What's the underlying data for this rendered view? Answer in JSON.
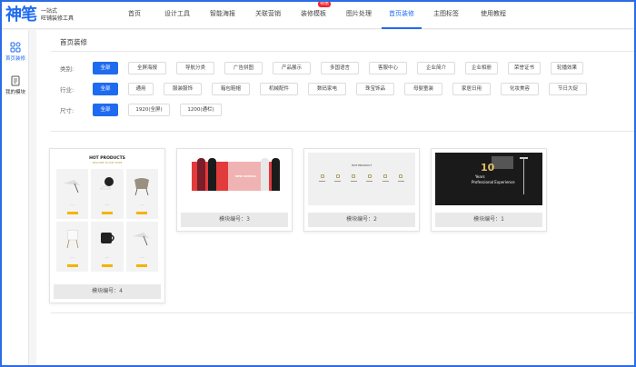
{
  "app": {
    "logo_mark": "神笔",
    "logo_line1": "一站式",
    "logo_line2": "旺铺装修工具"
  },
  "nav": {
    "items": [
      {
        "label": "首页"
      },
      {
        "label": "设计工具"
      },
      {
        "label": "智能海报"
      },
      {
        "label": "关联营销"
      },
      {
        "label": "装修模板",
        "badge": "特惠"
      },
      {
        "label": "图片处理"
      },
      {
        "label": "首页装修",
        "active": true
      },
      {
        "label": "主图标签"
      },
      {
        "label": "使用教程"
      }
    ]
  },
  "sidebar": {
    "items": [
      {
        "label": "首页装修",
        "icon": "grid-icon",
        "active": true
      },
      {
        "label": "我的模块",
        "icon": "document-icon"
      }
    ]
  },
  "page_title": "首页装修",
  "filters": {
    "category": {
      "label": "类别:",
      "options": [
        "全部",
        "全屏海报",
        "导航分类",
        "广告拼图",
        "产品展示",
        "多国语言",
        "客服中心",
        "企业简介",
        "企业相册",
        "荣誉证书",
        "轮播效果"
      ],
      "selected": "全部"
    },
    "industry": {
      "label": "行业:",
      "options": [
        "全部",
        "通用",
        "服装服饰",
        "箱包鞋帽",
        "机械配件",
        "数码家电",
        "珠宝饰品",
        "母婴童装",
        "家居日用",
        "化妆美容",
        "节日大促"
      ],
      "selected": "全部"
    },
    "size": {
      "label": "尺寸:",
      "options": [
        "全部",
        "1920(全屏)",
        "1200(通栏)"
      ],
      "selected": "全部"
    }
  },
  "templates": [
    {
      "label": "模块编号：4",
      "title": "HOT PRODUCTS",
      "subtitle": "WELCOME TO OUR STORE"
    },
    {
      "label": "模块编号：3",
      "thumb_text": "NEW ARRIVAL"
    },
    {
      "label": "模块编号：2",
      "thumb_text": "HOT PRODUCT"
    },
    {
      "label": "模块编号：1",
      "thumb_number": "10",
      "thumb_line1": "Years",
      "thumb_line2": "Professional Experience"
    }
  ],
  "colors": {
    "accent": "#1f6bf0",
    "border_frame": "#2b6be6",
    "badge": "#f5222d"
  }
}
